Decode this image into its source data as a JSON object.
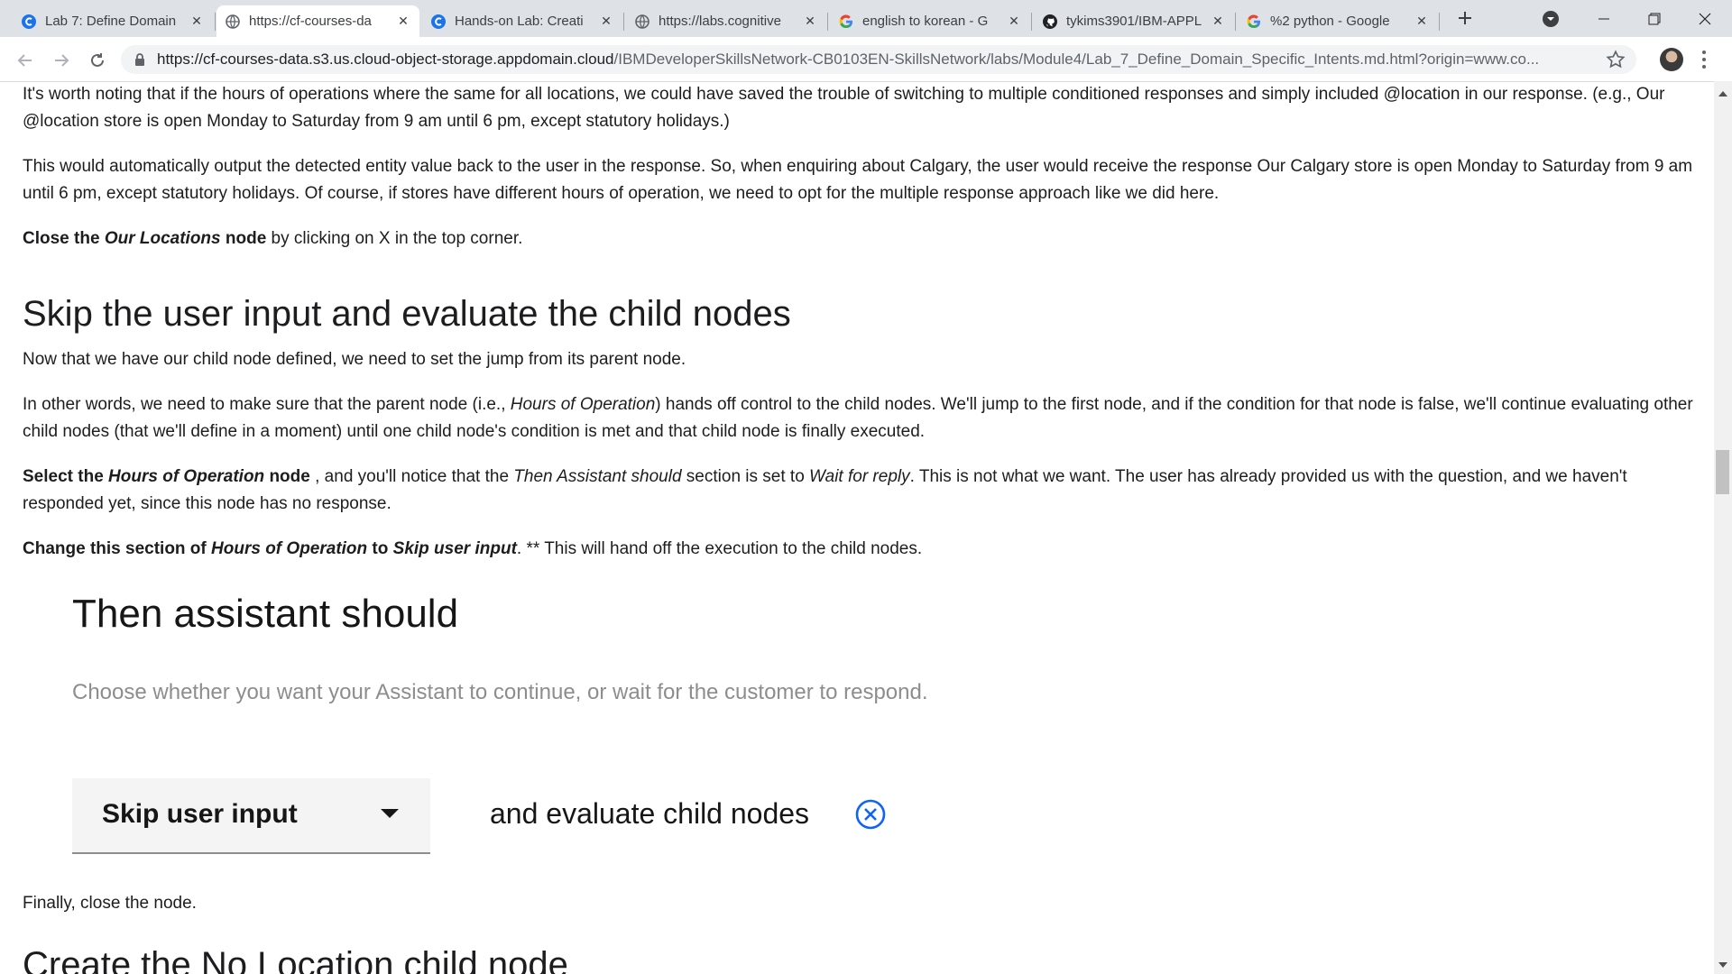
{
  "browser": {
    "tabs": [
      {
        "title": "Lab 7: Define Domain",
        "icon": "cognitive-class-icon"
      },
      {
        "title": "https://cf-courses-da",
        "icon": "globe-icon",
        "active": true
      },
      {
        "title": "Hands-on Lab: Creati",
        "icon": "cognitive-class-icon"
      },
      {
        "title": "https://labs.cognitive",
        "icon": "globe-icon"
      },
      {
        "title": "english to korean - G",
        "icon": "google-icon"
      },
      {
        "title": "tykims3901/IBM-APPL",
        "icon": "github-icon"
      },
      {
        "title": "%2 python - Google",
        "icon": "google-icon"
      }
    ],
    "url_host": "https://cf-courses-data.s3.us.cloud-object-storage.appdomain.cloud",
    "url_path": "/IBMDeveloperSkillsNetwork-CB0103EN-SkillsNetwork/labs/Module4/Lab_7_Define_Domain_Specific_Intents.md.html?origin=www.co..."
  },
  "doc": {
    "p1": "It's worth noting that if the hours of operations where the same for all locations, we could have saved the trouble of switching to multiple conditioned responses and simply included @location in our response. (e.g., Our @location store is open Monday to Saturday from 9 am until 6 pm, except statutory holidays.)",
    "p2": "This would automatically output the detected entity value back to the user in the response. So, when enquiring about Calgary, the user would receive the response Our Calgary store is open Monday to Saturday from 9 am until 6 pm, except statutory holidays. Of course, if stores have different hours of operation, we need to opt for the multiple response approach like we did here.",
    "p3_a": "Close the ",
    "p3_b": "Our Locations",
    "p3_c": " node",
    "p3_d": " by clicking on X in the top corner.",
    "heading": "Skip the user input and evaluate the child nodes",
    "p4": "Now that we have our child node defined, we need to set the jump from its parent node.",
    "p5_a": "In other words, we need to make sure that the parent node (i.e., ",
    "p5_b": "Hours of Operation",
    "p5_c": ") hands off control to the child nodes. We'll jump to the first node, and if the condition for that node is false, we'll continue evaluating other child nodes (that we'll define in a moment) until one child node's condition is met and that child node is finally executed.",
    "p6_a": "Select the ",
    "p6_b": "Hours of Operation",
    "p6_c": " node",
    "p6_d": " , and you'll notice that the ",
    "p6_e": "Then Assistant should",
    "p6_f": " section is set to ",
    "p6_g": "Wait for reply",
    "p6_h": ". This is not what we want. The user has already provided us with the question, and we haven't responded yet, since this node has no response.",
    "p7_a": "Change this section of ",
    "p7_b": "Hours of Operation",
    "p7_c": " to ",
    "p7_d": "Skip user input",
    "p7_e": ". ** This will hand off the execution to the child nodes.",
    "shot_title": "Then assistant should",
    "shot_sub": "Choose whether you want your Assistant to continue, or wait for the customer to respond.",
    "shot_dropdown": "Skip user input",
    "shot_eval": "and evaluate child nodes",
    "p8": "Finally, close the node.",
    "next_heading": "Create the No Location child node"
  }
}
